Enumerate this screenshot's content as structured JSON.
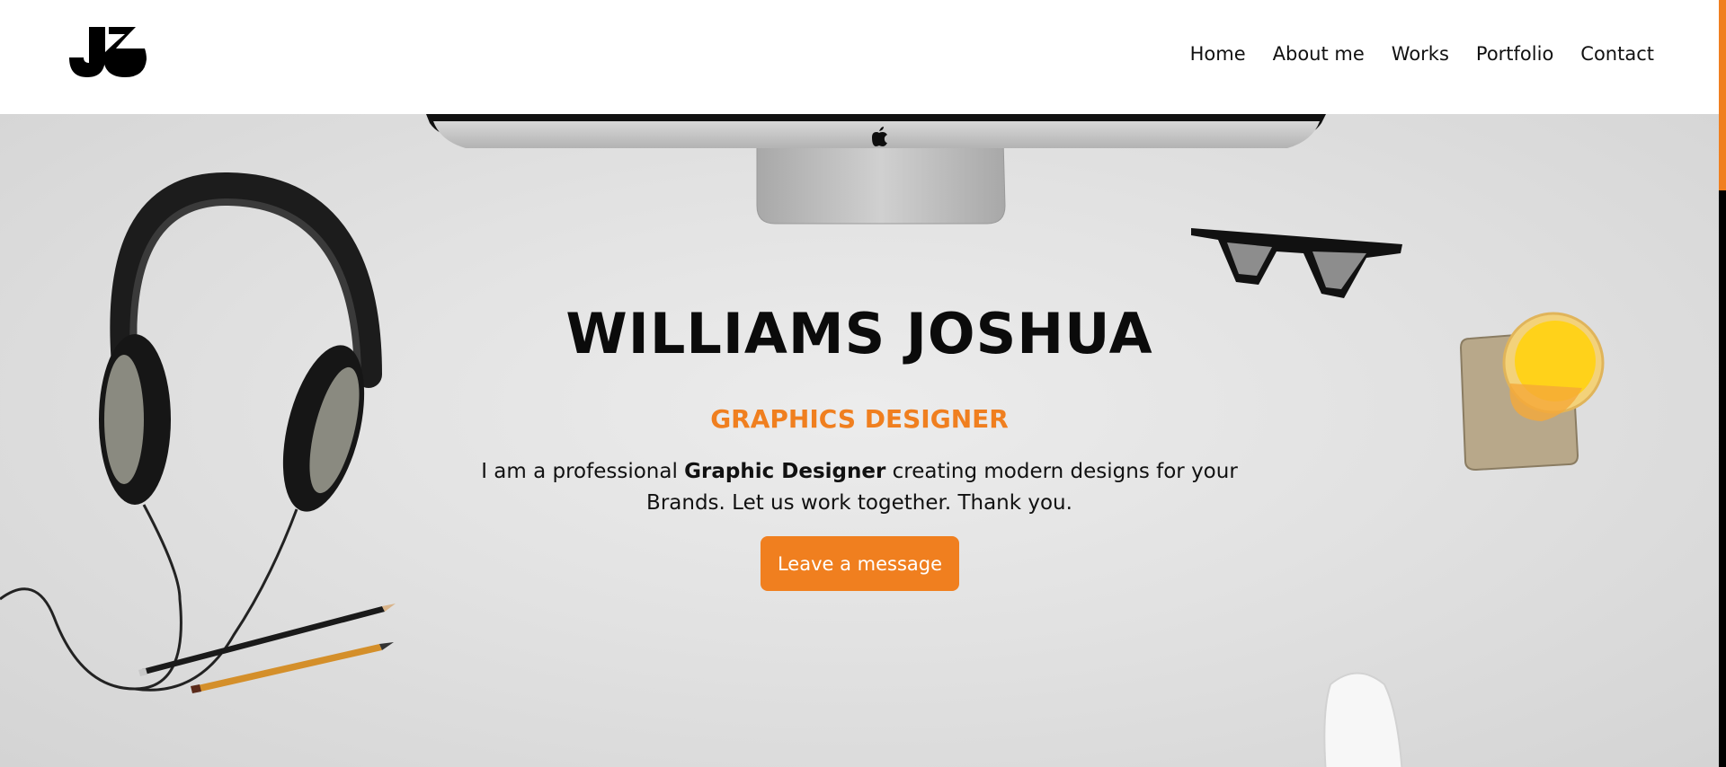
{
  "brand": {
    "logo_alt": "JJ",
    "accent_color": "#f07f1f",
    "text_color": "#0b0b0b"
  },
  "nav": {
    "items": [
      {
        "label": "Home"
      },
      {
        "label": "About me"
      },
      {
        "label": "Works"
      },
      {
        "label": "Portfolio"
      },
      {
        "label": "Contact"
      }
    ]
  },
  "hero": {
    "name": "WILLIAMS JOSHUA",
    "role": "GRAPHICS DESIGNER",
    "description_prefix": "I am a professional ",
    "description_bold": "Graphic Designer",
    "description_suffix": " creating modern designs for your Brands. Let us work together. Thank you.",
    "cta_label": "Leave a message"
  },
  "decorations": {
    "icons": [
      "monitor-icon",
      "apple-logo-icon",
      "headphones-icon",
      "glasses-icon",
      "juice-glass-icon",
      "pencil-icon",
      "mouse-icon"
    ]
  }
}
